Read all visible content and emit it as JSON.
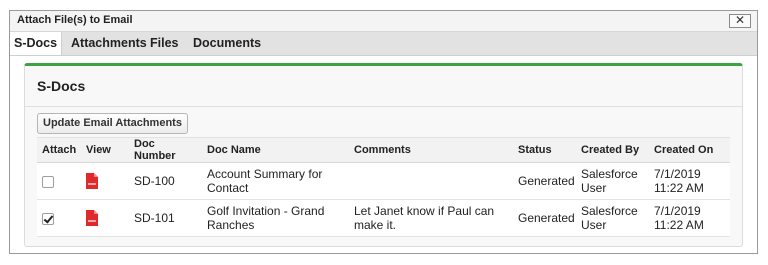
{
  "dialog": {
    "title": "Attach File(s) to Email",
    "close_label": "✕"
  },
  "tabs": [
    {
      "label": "S-Docs",
      "active": true
    },
    {
      "label": "Attachments",
      "active": false
    },
    {
      "label": "Files",
      "active": false
    },
    {
      "label": "Documents",
      "active": false
    }
  ],
  "panel": {
    "title": "S-Docs",
    "accent_color": "#3ea33e",
    "update_button_label": "Update Email Attachments"
  },
  "table": {
    "columns": [
      "Attach",
      "View",
      "Doc Number",
      "Doc Name",
      "Comments",
      "Status",
      "Created By",
      "Created On"
    ],
    "rows": [
      {
        "checked": false,
        "view_icon": "pdf-icon",
        "doc_number": "SD-100",
        "doc_name": "Account Summary for Contact",
        "comments": "",
        "status": "Generated",
        "created_by": "Salesforce User",
        "created_on": "7/1/2019 11:22 AM"
      },
      {
        "checked": true,
        "view_icon": "pdf-icon",
        "doc_number": "SD-101",
        "doc_name": "Golf Invitation - Grand Ranches",
        "comments": "Let Janet know if Paul can make it.",
        "status": "Generated",
        "created_by": "Salesforce User",
        "created_on": "7/1/2019 11:22 AM"
      }
    ]
  }
}
